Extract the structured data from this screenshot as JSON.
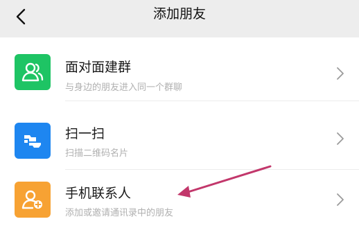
{
  "header": {
    "title": "添加朋友",
    "back_icon": "chevron-left-icon"
  },
  "items": [
    {
      "label": "面对面建群",
      "subtitle": "与身边的朋友进入同一个群聊",
      "icon": "face-to-face-group-icon",
      "icon_color": "#1ec464"
    },
    {
      "label": "扫一扫",
      "subtitle": "扫描二维码名片",
      "icon": "scan-icon",
      "icon_color": "#1e86f0"
    },
    {
      "label": "手机联系人",
      "subtitle": "添加或邀请通讯录中的朋友",
      "icon": "add-contact-icon",
      "icon_color": "#f7a233"
    }
  ],
  "annotation_color": "#c2376b"
}
